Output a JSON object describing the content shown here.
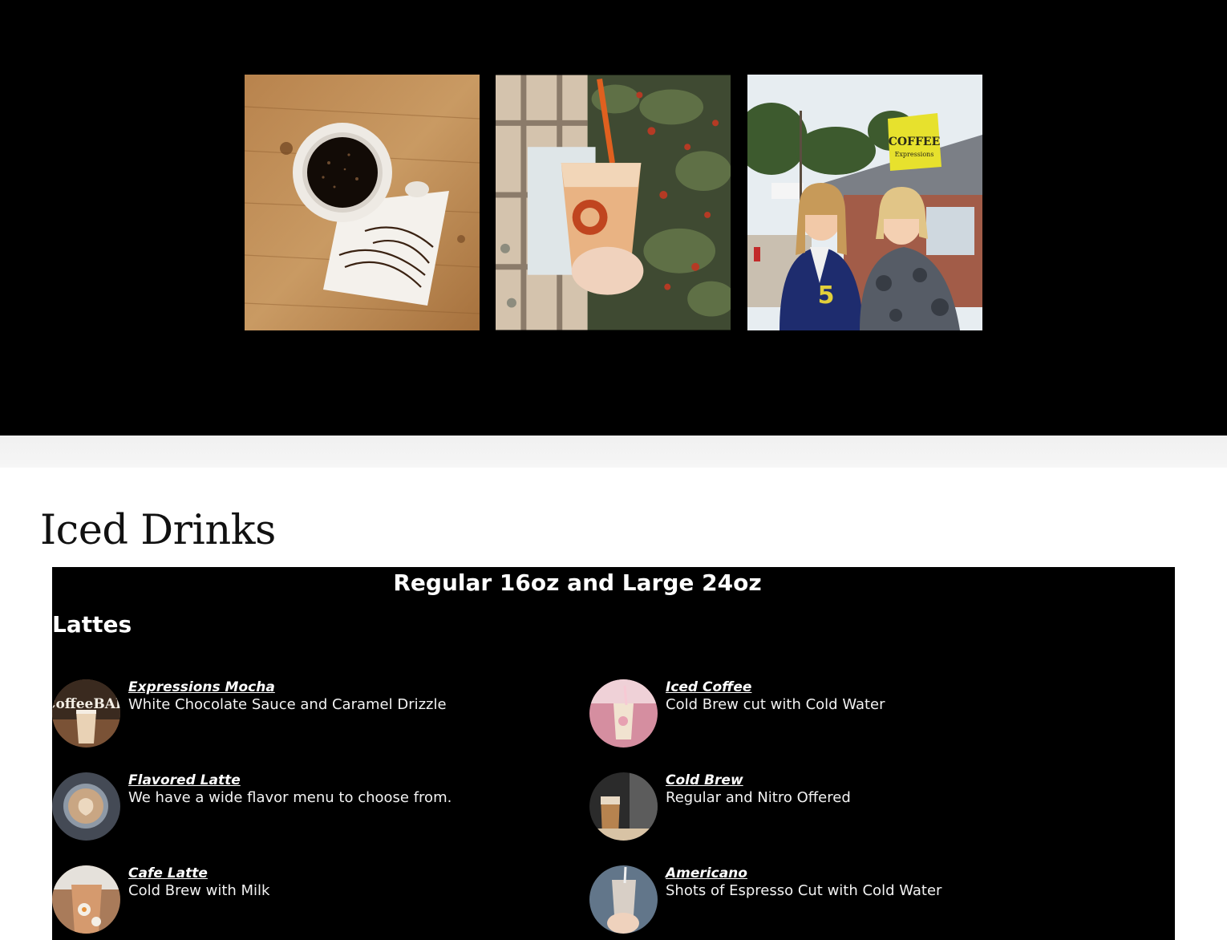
{
  "gallery": {
    "images": [
      {
        "name": "coffee-cup-on-table-photo"
      },
      {
        "name": "iced-drink-in-hand-photo"
      },
      {
        "name": "coffee-shop-storefront-photo",
        "sign_text": "COFFEE Expressions"
      }
    ]
  },
  "section": {
    "title": "Iced Drinks"
  },
  "menu": {
    "sizes_heading": "Regular 16oz and Large 24oz",
    "category": "Lattes",
    "items": [
      {
        "name": "Expressions Mocha",
        "description": "White Chocolate Sauce and Caramel Drizzle",
        "thumb_text": "CoffeeBAR"
      },
      {
        "name": "Iced Coffee",
        "description": "Cold Brew cut with Cold Water"
      },
      {
        "name": "Flavored Latte",
        "description": "We have a wide flavor menu to choose from."
      },
      {
        "name": "Cold Brew",
        "description": "Regular and Nitro Offered"
      },
      {
        "name": "Cafe Latte",
        "description": "Cold Brew with Milk"
      },
      {
        "name": "Americano",
        "description": "Shots of Espresso Cut with Cold Water"
      }
    ]
  },
  "colors": {
    "hero_background": "#000000",
    "panel_background": "#000000",
    "band_grey": "#f3f3f3",
    "text_light": "#ffffff",
    "title_dark": "#111111"
  }
}
